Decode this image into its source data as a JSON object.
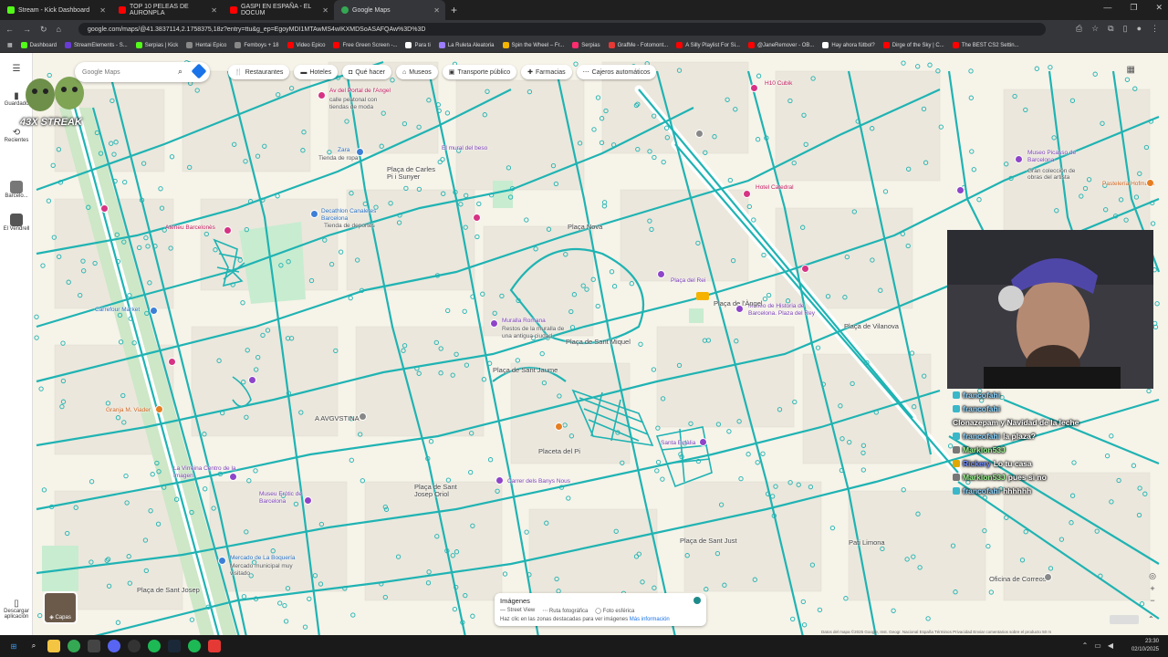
{
  "browser": {
    "tabs": [
      {
        "title": "Stream - Kick Dashboard",
        "color": "#53fc18"
      },
      {
        "title": "TOP 10 PELEAS DE AURONPLA",
        "color": "#ff0000"
      },
      {
        "title": "GASPI EN ESPAÑA - EL DOCUM",
        "color": "#ff0000"
      },
      {
        "title": "Google Maps",
        "color": "#34a853"
      }
    ],
    "url": "google.com/maps/@41.3837114,2.1758375,18z?entry=ttu&g_ep=EgoyMDI1MTAwMS4wIKXMDSoASAFQAw%3D%3D",
    "bookmarks": [
      {
        "label": "Dashboard",
        "color": "#53fc18"
      },
      {
        "label": "StreamElements - S...",
        "color": "#6a3cd6"
      },
      {
        "label": "Serpias | Kick",
        "color": "#53fc18"
      },
      {
        "label": "Hentai Epico",
        "color": "#888888"
      },
      {
        "label": "Femboys + 18",
        "color": "#888888"
      },
      {
        "label": "Video Epico",
        "color": "#ff0000"
      },
      {
        "label": "Free Green Screen -...",
        "color": "#ff0000"
      },
      {
        "label": "Para ti",
        "color": "#ffffff"
      },
      {
        "label": "La Ruleta Aleatoria",
        "color": "#9c7cff"
      },
      {
        "label": "Spin the Wheel – Fr...",
        "color": "#f4b400"
      },
      {
        "label": "Serpias",
        "color": "#ff2d6f"
      },
      {
        "label": "GrafMe - Fotomont...",
        "color": "#e53935"
      },
      {
        "label": "A Silly Playlist For Si...",
        "color": "#ff0000"
      },
      {
        "label": "@JaneRemover - OB...",
        "color": "#ff0000"
      },
      {
        "label": "Hay ahora fútbol?",
        "color": "#ffffff"
      },
      {
        "label": "Dirge of the Sky | C...",
        "color": "#ff0000"
      },
      {
        "label": "The BEST CS2 Settin...",
        "color": "#ff0000"
      }
    ]
  },
  "maps": {
    "search_placeholder": "Google Maps",
    "chips": [
      "Restaurantes",
      "Hoteles",
      "Qué hacer",
      "Museos",
      "Transporte público",
      "Farmacias",
      "Cajeros automáticos"
    ],
    "rail": {
      "saved": "Guardado",
      "recent": "Recientes",
      "barcelona": "Barcelo...",
      "vendrell": "El Vendrell",
      "download": "Descargar aplicación"
    },
    "places": [
      {
        "name": "Av del Portal de l'Angel",
        "type": "pink"
      },
      {
        "name": "calle peatonal con tiendas de moda",
        "type": "grey"
      },
      {
        "name": "Zara",
        "type": "blue"
      },
      {
        "name": "Tienda de ropa",
        "type": "grey"
      },
      {
        "name": "Plaça de Carles Pi i Sunyer",
        "type": "grey"
      },
      {
        "name": "El mural del beso",
        "type": "purple"
      },
      {
        "name": "Decathlon Canaletes Barcelona",
        "type": "blue"
      },
      {
        "name": "Tienda de deportes",
        "type": "grey"
      },
      {
        "name": "Ateneu Barcelonès",
        "type": "pink"
      },
      {
        "name": "Plaça Nova",
        "type": "grey"
      },
      {
        "name": "Carrefour Market",
        "type": "blue"
      },
      {
        "name": "Muralla Romana",
        "type": "purple"
      },
      {
        "name": "Restos de la muralla de una antigua ciudad",
        "type": "grey"
      },
      {
        "name": "Plaça del Rei",
        "type": "purple"
      },
      {
        "name": "Museo de Historia de Barcelona. Plaza del Rey",
        "type": "purple"
      },
      {
        "name": "Plaça de Sant Jaume",
        "type": "grey"
      },
      {
        "name": "Granja M. Viader",
        "type": "orange"
      },
      {
        "name": "A AVGVSTINA",
        "type": "grey"
      },
      {
        "name": "La Virreina Centro de la Imagen",
        "type": "purple"
      },
      {
        "name": "Museu Eròtic de Barcelona",
        "type": "purple"
      },
      {
        "name": "Carrer dels Banys Nous",
        "type": "purple"
      },
      {
        "name": "Santa Eulàlia",
        "type": "purple"
      },
      {
        "name": "Mercado de La Boquería",
        "type": "blue"
      },
      {
        "name": "Mercado municipal muy visitado",
        "type": "grey"
      },
      {
        "name": "Museo Picasso de Barcelona",
        "type": "purple"
      },
      {
        "name": "Gran colección de obras del artista",
        "type": "grey"
      },
      {
        "name": "Pastelería Hofmann",
        "type": "orange"
      },
      {
        "name": "H10 Cubik",
        "type": "pink"
      },
      {
        "name": "Hotel Catedral",
        "type": "pink"
      },
      {
        "name": "Placeta del Pi",
        "type": "grey"
      },
      {
        "name": "Plaça de Sant Josep Oriol",
        "type": "grey"
      },
      {
        "name": "Plaça de Sant Miquel",
        "type": "grey"
      },
      {
        "name": "Plaça de Sant Just",
        "type": "grey"
      },
      {
        "name": "Oficina de Correos",
        "type": "grey"
      },
      {
        "name": "Pati Limona",
        "type": "grey"
      },
      {
        "name": "Plaça de l'Àngel",
        "type": "grey"
      },
      {
        "name": "Plaça de Sant Josep",
        "type": "grey"
      },
      {
        "name": "Plaça de Vilanova",
        "type": "grey"
      }
    ],
    "imagery": {
      "title": "Imágenes",
      "street_view": "Street View",
      "photo_route": "Ruta fotográfica",
      "spherical": "Foto esférica",
      "hint": "Haz clic en las zonas destacadas para ver imágenes",
      "more": "Más información"
    },
    "layers_label": "Capas",
    "footer": "Datos del mapa ©2025 Google, Inst. Geogr. Nacional    España    Términos    Privacidad    Enviar comentarios sobre el producto    50 m"
  },
  "overlay": {
    "streak": "43X STREAK",
    "chat": [
      {
        "user": "francofahi",
        "msg": "",
        "color": "u1"
      },
      {
        "user": "francofahi",
        "msg": "",
        "color": "u1"
      },
      {
        "user": "",
        "msg": "Clonazepam y Navidad de la leche",
        "color": "u1"
      },
      {
        "user": "francofahi",
        "msg": "la plaza?",
        "color": "u1"
      },
      {
        "user": "Marklon53J",
        "msg": "",
        "color": "u2"
      },
      {
        "user": "Rickery",
        "msg": "Lo tu casa",
        "color": "u3"
      },
      {
        "user": "Marklon53J",
        "msg": "pues si no",
        "color": "u2"
      },
      {
        "user": "francofahi",
        "msg": "hhhhhh",
        "color": "u1"
      }
    ]
  },
  "taskbar": {
    "time": "23:30",
    "date": "02/10/2025"
  },
  "colors": {
    "street_view_line": "#1fb3b3",
    "map_bg": "#f6f3e9",
    "park": "#c8ecd0"
  }
}
